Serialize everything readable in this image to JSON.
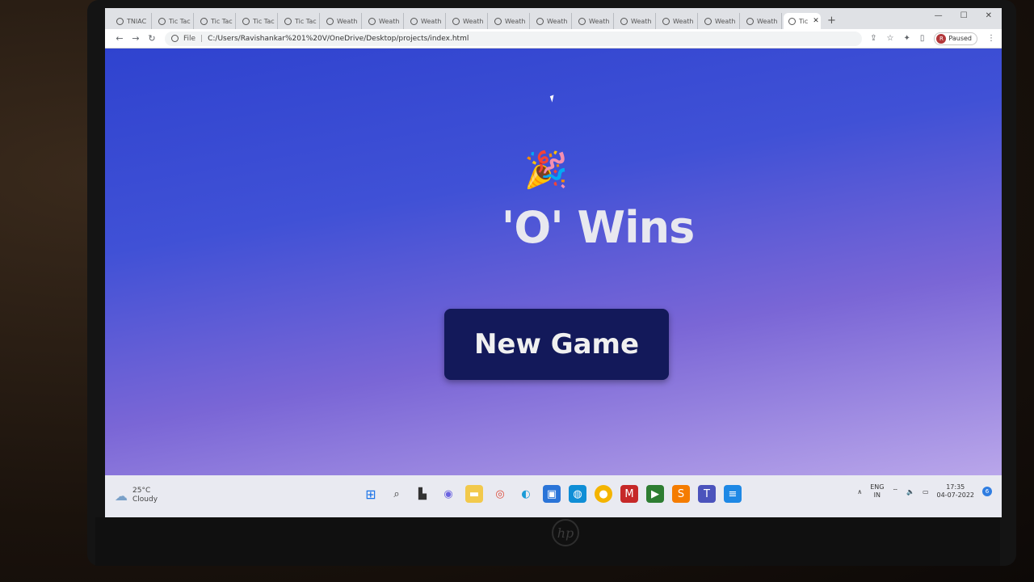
{
  "browser": {
    "tabs": [
      {
        "label": "TNIAC"
      },
      {
        "label": "Tic Tac"
      },
      {
        "label": "Tic Tac"
      },
      {
        "label": "Tic Tac"
      },
      {
        "label": "Tic Tac"
      },
      {
        "label": "Weath"
      },
      {
        "label": "Weath"
      },
      {
        "label": "Weath"
      },
      {
        "label": "Weath"
      },
      {
        "label": "Weath"
      },
      {
        "label": "Weath"
      },
      {
        "label": "Weath"
      },
      {
        "label": "Weath"
      },
      {
        "label": "Weath"
      },
      {
        "label": "Weath"
      },
      {
        "label": "Weath"
      }
    ],
    "active_tab": {
      "label": "Tic"
    },
    "new_tab_symbol": "+",
    "url_scheme": "File",
    "url": "C:/Users/Ravishankar%201%20V/OneDrive/Desktop/projects/index.html",
    "profile_initial": "R",
    "profile_status": "Paused"
  },
  "game": {
    "emoji": "🎉",
    "result_message": "'O' Wins",
    "new_game_label": "New Game"
  },
  "taskbar": {
    "weather_temp": "25°C",
    "weather_condition": "Cloudy",
    "language": "ENG",
    "region": "IN",
    "time": "17:35",
    "date": "04-07-2022",
    "notification_count": "6"
  },
  "device": {
    "brand": "hp"
  }
}
